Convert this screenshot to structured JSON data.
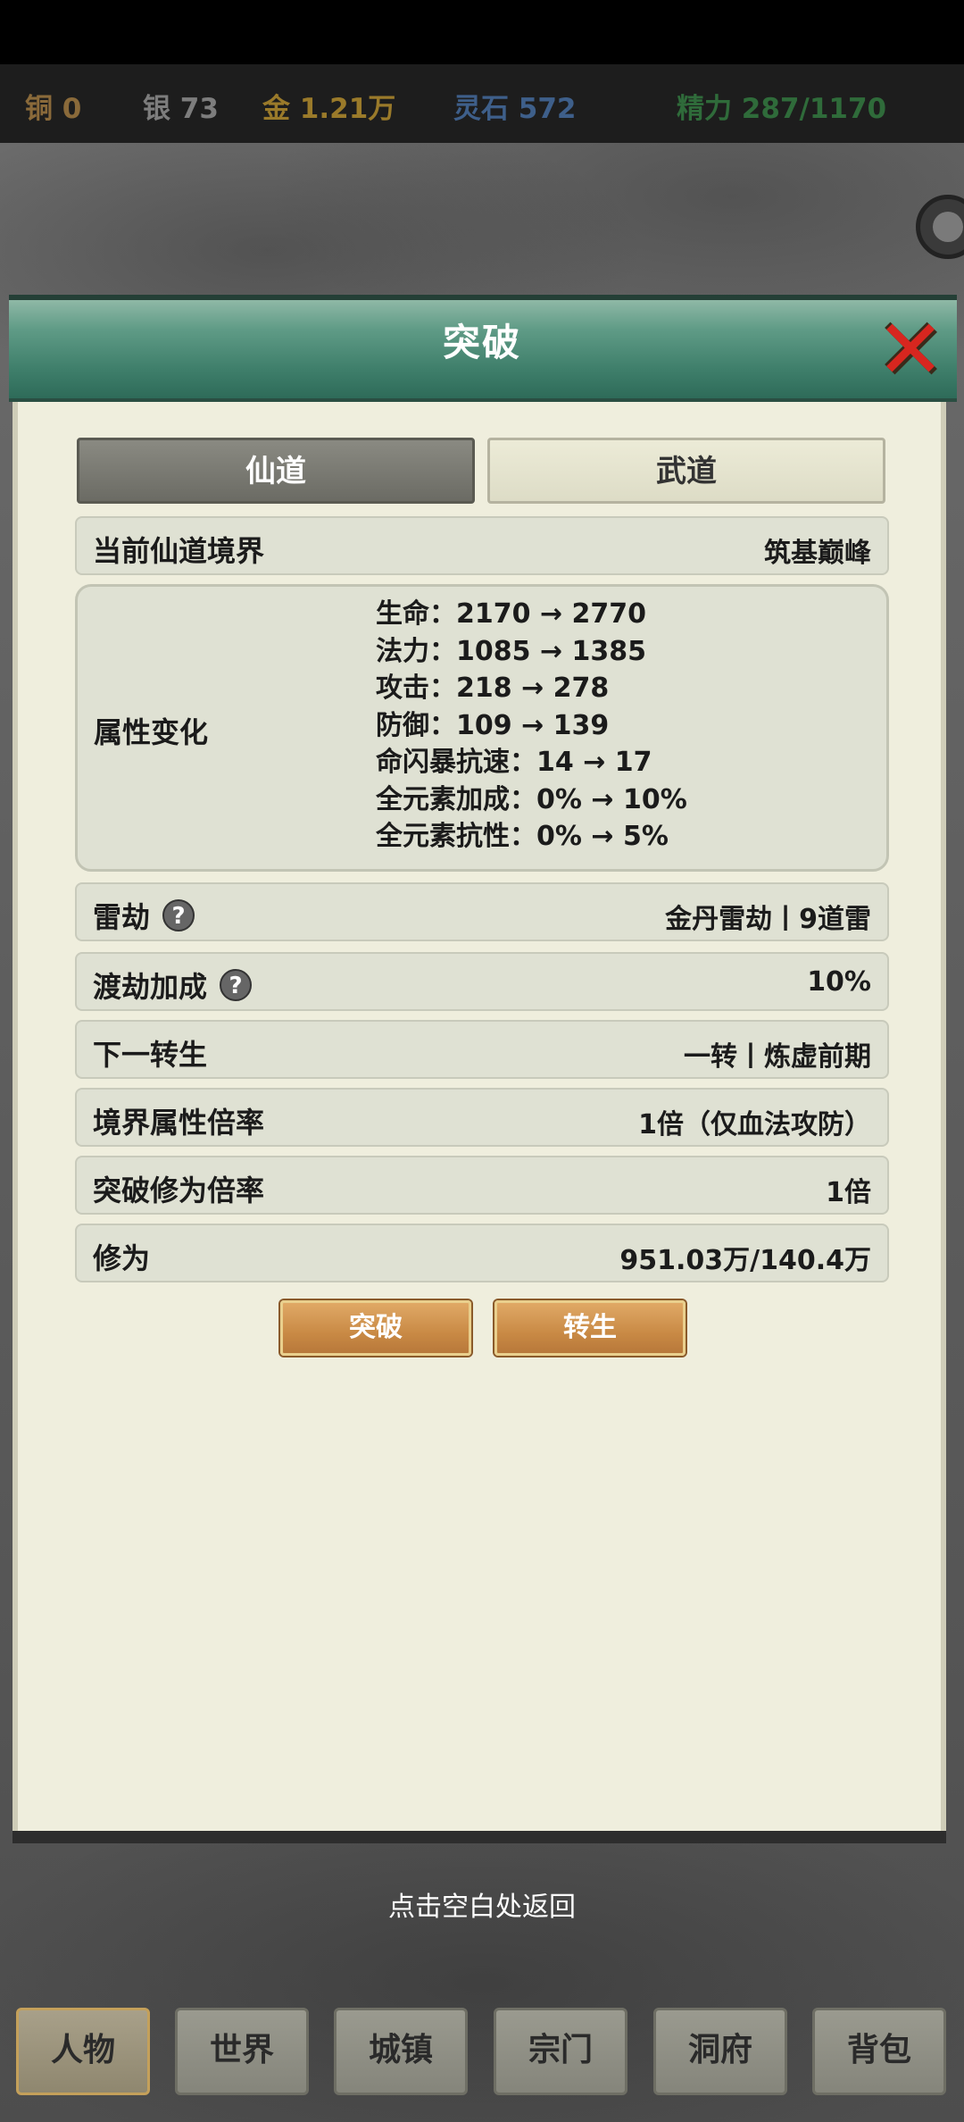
{
  "resources": {
    "copper": {
      "text": "铜 0",
      "color": "#8a6a3a"
    },
    "silver": {
      "text": "银 73",
      "color": "#7d7d7d"
    },
    "gold": {
      "text": "金 1.21万",
      "color": "#9a7a2a"
    },
    "spirit_stone": {
      "text": "灵石 572",
      "color": "#3e5f8a"
    },
    "energy": {
      "text": "精力 287/1170",
      "color": "#2f6b3a"
    }
  },
  "dialog": {
    "title": "突破",
    "close_icon": "close-x",
    "tabs": [
      {
        "label": "仙道",
        "active": true
      },
      {
        "label": "武道",
        "active": false
      }
    ],
    "realm": {
      "label": "当前仙道境界",
      "value": "筑基巅峰"
    },
    "attributes": {
      "label": "属性变化",
      "lines": [
        "生命：2170 → 2770",
        "法力：1085 → 1385",
        "攻击：218 → 278",
        "防御：109 → 139",
        "命闪暴抗速：14 → 17",
        "全元素加成：0% → 10%",
        "全元素抗性：0% → 5%"
      ]
    },
    "rows": [
      {
        "label": "雷劫",
        "value": "金丹雷劫丨9道雷",
        "help": true
      },
      {
        "label": "渡劫加成",
        "value": "10%",
        "help": true
      },
      {
        "label": "下一转生",
        "value": "一转丨炼虚前期",
        "help": false
      },
      {
        "label": "境界属性倍率",
        "value": "1倍（仅血法攻防）",
        "help": false
      },
      {
        "label": "突破修为倍率",
        "value": "1倍",
        "help": false
      },
      {
        "label": "修为",
        "value": "951.03万/140.4万",
        "help": false
      }
    ],
    "help_glyph": "?",
    "buttons": {
      "breakthrough": "突破",
      "rebirth": "转生"
    }
  },
  "hint": "点击空白处返回",
  "nav": [
    {
      "label": "人物",
      "active": true
    },
    {
      "label": "世界",
      "active": false
    },
    {
      "label": "城镇",
      "active": false
    },
    {
      "label": "宗门",
      "active": false
    },
    {
      "label": "洞府",
      "active": false
    },
    {
      "label": "背包",
      "active": false
    }
  ]
}
